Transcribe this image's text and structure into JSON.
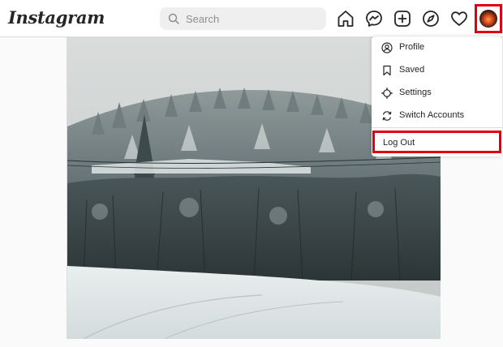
{
  "brand": {
    "logo_text": "Instagram"
  },
  "search": {
    "placeholder": "Search"
  },
  "nav": {
    "icons": [
      "home-icon",
      "messenger-icon",
      "new-post-icon",
      "explore-icon",
      "activity-heart-icon",
      "profile-avatar"
    ]
  },
  "highlight_color": "#e0000f",
  "dropdown": {
    "items": [
      {
        "label": "Profile",
        "icon": "profile-icon"
      },
      {
        "label": "Saved",
        "icon": "bookmark-icon"
      },
      {
        "label": "Settings",
        "icon": "settings-icon"
      },
      {
        "label": "Switch Accounts",
        "icon": "switch-icon"
      }
    ],
    "logout_label": "Log Out"
  }
}
